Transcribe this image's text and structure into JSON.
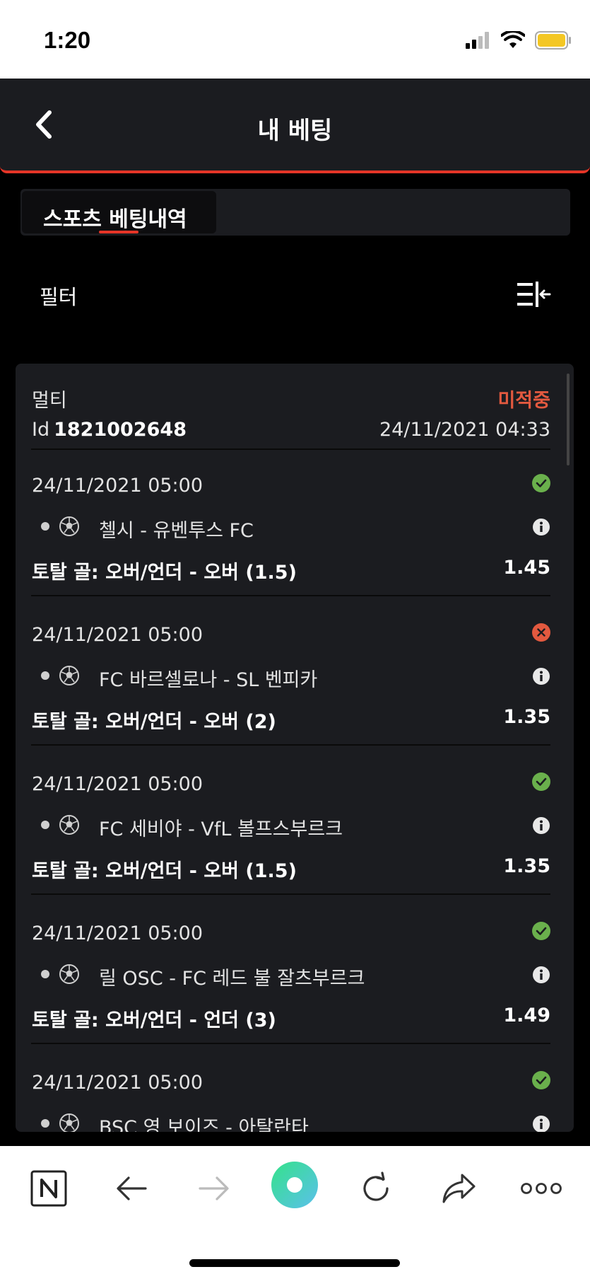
{
  "status_bar": {
    "time": "1:20"
  },
  "header": {
    "title": "내 베팅"
  },
  "tabs": [
    {
      "label": "스포츠 베팅내역",
      "active": true
    }
  ],
  "filter": {
    "label": "필터"
  },
  "ticket": {
    "type": "멀티",
    "status": "미적중",
    "id_label": "Id",
    "id": "1821002648",
    "date": "24/11/2021 04:33",
    "bets": [
      {
        "date": "24/11/2021 05:00",
        "match": "첼시 - 유벤투스 FC",
        "market": "토탈 골: 오버/언더 - 오버 (1.5)",
        "odds": "1.45",
        "result": "won"
      },
      {
        "date": "24/11/2021 05:00",
        "match": "FC 바르셀로나 - SL 벤피카",
        "market": "토탈 골: 오버/언더 - 오버 (2)",
        "odds": "1.35",
        "result": "lost"
      },
      {
        "date": "24/11/2021 05:00",
        "match": "FC 세비야 - VfL 볼프스부르크",
        "market": "토탈 골: 오버/언더 - 오버 (1.5)",
        "odds": "1.35",
        "result": "won"
      },
      {
        "date": "24/11/2021 05:00",
        "match": "릴 OSC - FC 레드 불 잘츠부르크",
        "market": "토탈 골: 오버/언더 - 언더 (3)",
        "odds": "1.49",
        "result": "won"
      },
      {
        "date": "24/11/2021 05:00",
        "match": "BSC 영 보이즈 - 아탈란타",
        "market": "",
        "odds": "",
        "result": "won"
      }
    ]
  },
  "colors": {
    "accent": "#e53527",
    "won": "#6ab04c",
    "lost": "#e2593f",
    "card_bg": "#1b1c20"
  },
  "toolbar": {
    "icons": [
      "naver-n-icon",
      "arrow-left-icon",
      "arrow-right-icon",
      "green-home-icon",
      "refresh-icon",
      "share-icon",
      "more-icon"
    ]
  }
}
